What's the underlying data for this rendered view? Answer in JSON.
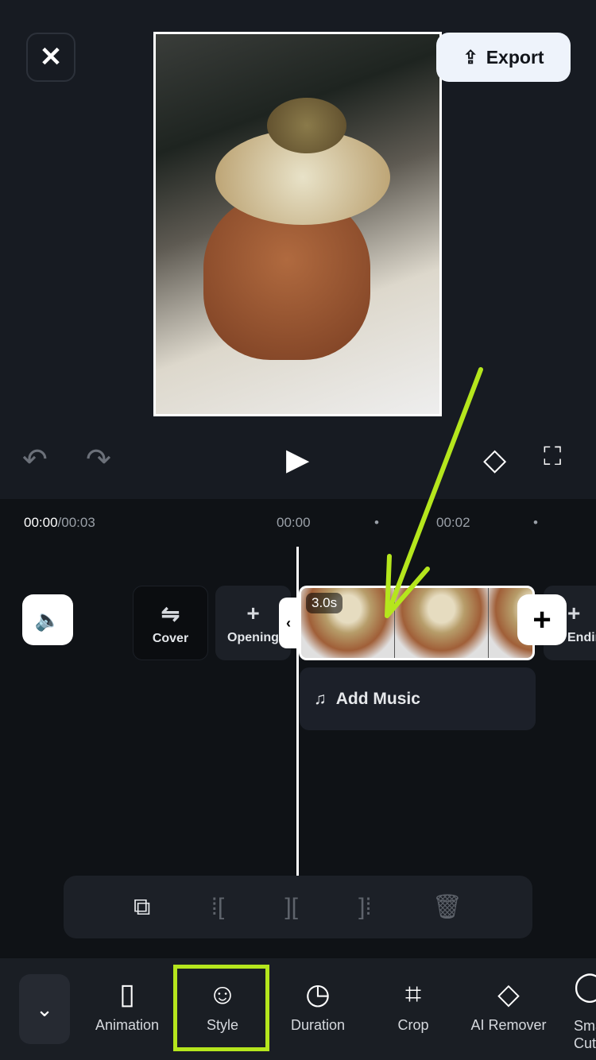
{
  "header": {
    "close_icon": "close-icon",
    "export_label": "Export",
    "export_icon": "upload-icon"
  },
  "preview": {
    "content": "photo of pistachio cream cruffin"
  },
  "controls": {
    "undo": "undo-icon",
    "redo": "redo-icon",
    "play": "play-icon",
    "keyframe": "keyframe-add-icon",
    "fullscreen": "fullscreen-icon"
  },
  "timeline": {
    "current": "00:00",
    "total": "/00:03",
    "ticks": [
      "00:00",
      "•",
      "00:02",
      "•"
    ],
    "cover_label": "Cover",
    "opening_label": "Opening",
    "ending_label": "Ending",
    "clip_duration": "3.0s",
    "add_music_label": "Add Music"
  },
  "edit_tools": [
    "duplicate-icon",
    "split-left-icon",
    "split-icon",
    "split-right-icon",
    "delete-icon"
  ],
  "toolbar": {
    "items": [
      {
        "label": "Animation",
        "icon": "animation-icon"
      },
      {
        "label": "Style",
        "icon": "style-smiley-icon"
      },
      {
        "label": "Duration",
        "icon": "clock-icon"
      },
      {
        "label": "Crop",
        "icon": "crop-icon"
      },
      {
        "label": "AI Remover",
        "icon": "ai-eraser-icon"
      },
      {
        "label": "Smart Cut",
        "icon": "smart-cut-icon"
      }
    ]
  },
  "annotation": {
    "highlight_color": "#b5e61d"
  }
}
